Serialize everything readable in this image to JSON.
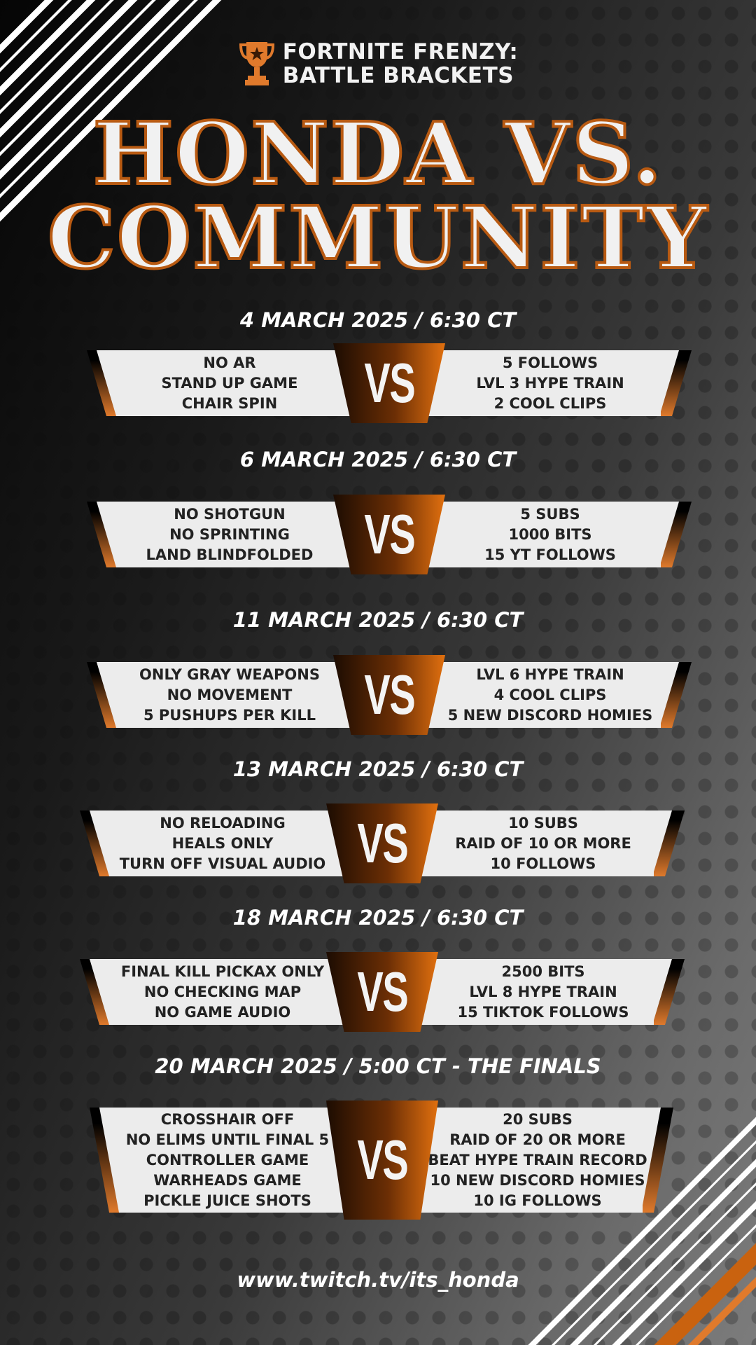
{
  "brand": {
    "line1": "FORTNITE FRENZY:",
    "line2": "BATTLE BRACKETS",
    "icon": "trophy-icon"
  },
  "headline": {
    "line1": "HONDA VS.",
    "line2": "COMMUNITY"
  },
  "vs_label": "VS",
  "colors": {
    "accent": "#e1700f",
    "accent_dark": "#6b2e05",
    "panel": "#ececec",
    "outline": "#b85a12"
  },
  "matches": [
    {
      "date": "4 MARCH 2025  /  6:30 CT",
      "left": [
        "NO AR",
        "STAND UP GAME",
        "CHAIR SPIN"
      ],
      "right": [
        "5 FOLLOWS",
        "LVL 3 HYPE TRAIN",
        "2 COOL CLIPS"
      ]
    },
    {
      "date": "6 MARCH 2025 / 6:30 CT",
      "left": [
        "NO SHOTGUN",
        "NO SPRINTING",
        "LAND BLINDFOLDED"
      ],
      "right": [
        "5 SUBS",
        "1000 BITS",
        "15 YT FOLLOWS"
      ]
    },
    {
      "date": "11 MARCH 2025 / 6:30 CT",
      "left": [
        "ONLY GRAY WEAPONS",
        "NO MOVEMENT",
        "5 PUSHUPS PER KILL"
      ],
      "right": [
        "LVL 6 HYPE TRAIN",
        "4 COOL CLIPS",
        "5 NEW DISCORD HOMIES"
      ]
    },
    {
      "date": "13 MARCH 2025 / 6:30 CT",
      "left": [
        "NO RELOADING",
        "HEALS ONLY",
        "TURN OFF VISUAL AUDIO"
      ],
      "right": [
        "10 SUBS",
        "RAID OF 10 OR MORE",
        "10 FOLLOWS"
      ]
    },
    {
      "date": "18 MARCH 2025 / 6:30 CT",
      "left": [
        "FINAL KILL PICKAX ONLY",
        "NO CHECKING MAP",
        "NO GAME AUDIO"
      ],
      "right": [
        "2500 BITS",
        "LVL 8 HYPE TRAIN",
        "15 TIKTOK FOLLOWS"
      ]
    },
    {
      "date": "20 MARCH  2025 / 5:00 CT - THE FINALS",
      "left": [
        "CROSSHAIR OFF",
        "NO ELIMS UNTIL FINAL 5",
        "CONTROLLER GAME",
        "WARHEADS GAME",
        "PICKLE JUICE SHOTS"
      ],
      "right": [
        "20 SUBS",
        "RAID OF 20 OR MORE",
        "BEAT HYPE TRAIN RECORD",
        "10 NEW DISCORD HOMIES",
        "10 IG FOLLOWS"
      ]
    }
  ],
  "footer": {
    "url": "www.twitch.tv/its_honda"
  }
}
